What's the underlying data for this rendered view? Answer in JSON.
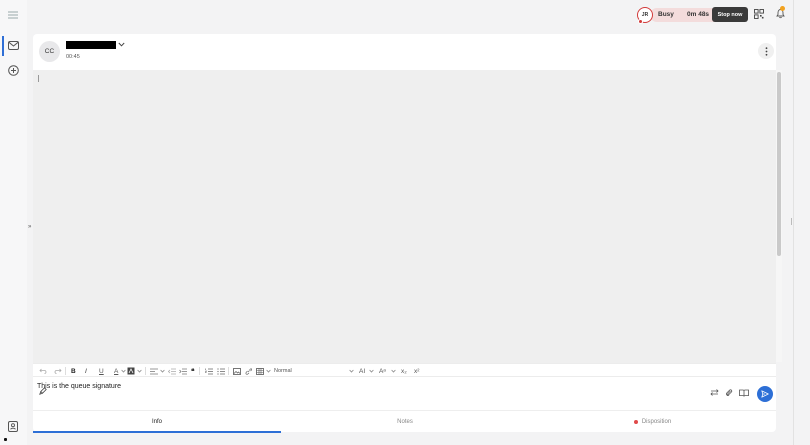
{
  "status": {
    "initials": "JR",
    "label": "Busy",
    "timer": "0m 48s",
    "stop_label": "Stop now",
    "color": "#d23a3a"
  },
  "conversation": {
    "avatar_initials": "CC",
    "call_timer": "00:45"
  },
  "editor": {
    "ellipsis": "•••",
    "signature": "This is the queue signature",
    "toolbar": {
      "bold": "B",
      "italic": "I",
      "underline": "U",
      "text_color": "A",
      "quote": "❝",
      "font_size": "Normal",
      "ai": "AI",
      "text_size": "Aᵃ",
      "subscript": "x₂",
      "superscript": "x²"
    }
  },
  "tabs": [
    {
      "label": "Info",
      "active": true
    },
    {
      "label": "Notes",
      "active": false
    },
    {
      "label": "Disposition",
      "active": false
    }
  ],
  "colors": {
    "accent": "#2d6fd6",
    "busy_bg": "#f3dcdc",
    "notification": "#f2a21f"
  },
  "icons": [
    "menu-icon",
    "mail-icon",
    "add-circle-icon",
    "contact-icon",
    "chevron-down-icon",
    "qr-code-icon",
    "bell-icon",
    "more-vertical-icon",
    "send-icon",
    "paint-brush-icon",
    "swap-icon",
    "attach-icon",
    "book-icon"
  ]
}
